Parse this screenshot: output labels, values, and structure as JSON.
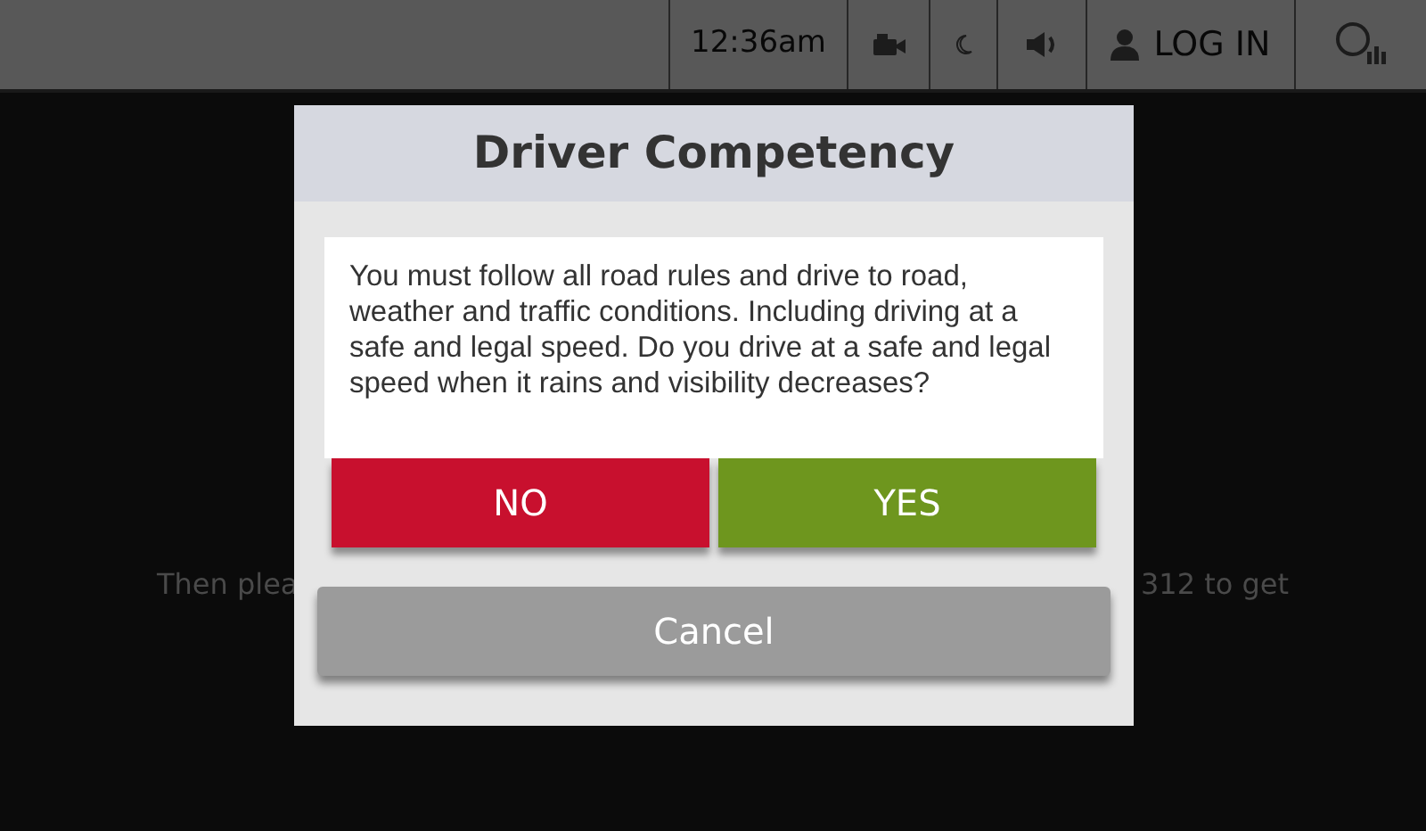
{
  "top_bar": {
    "time": "12:36am",
    "login": "LOG IN"
  },
  "background_text": {
    "left": "Then plea",
    "right": "312 to get"
  },
  "dialog": {
    "title": "Driver Competency",
    "message": "You must follow all road rules and drive to road, weather and traffic conditions. Including driving at a safe and legal speed. Do you drive at a safe and legal speed when it rains and visibility decreases?",
    "buttons": [
      {
        "label": "NO",
        "kind": "no"
      },
      {
        "label": "YES",
        "kind": "yes"
      }
    ],
    "cancel": "Cancel"
  }
}
